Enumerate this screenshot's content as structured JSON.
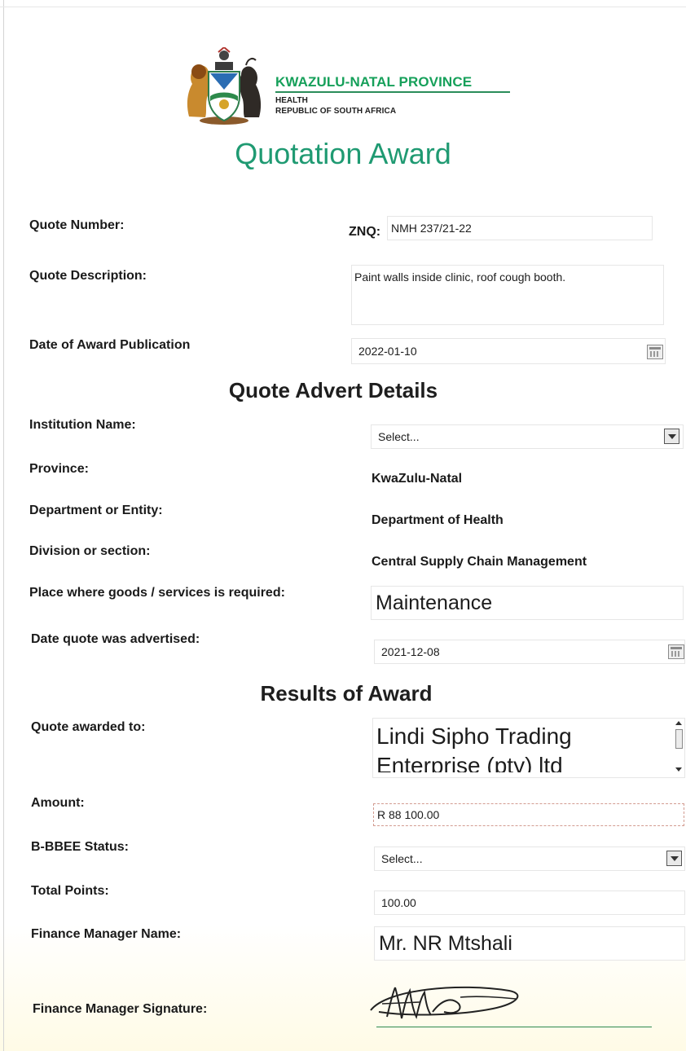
{
  "header": {
    "province": "KWAZULU-NATAL PROVINCE",
    "department": "HEALTH",
    "country": "REPUBLIC OF SOUTH AFRICA",
    "logo": "coat-of-arms-icon"
  },
  "title": "Quotation Award",
  "quote": {
    "number_label": "Quote Number:",
    "number_prefix": "ZNQ:",
    "number_value": "NMH 237/21-22",
    "description_label": "Quote Description:",
    "description_value": "Paint walls inside clinic, roof cough booth.",
    "award_date_label": "Date of Award Publication",
    "award_date_value": "2022-01-10"
  },
  "advert": {
    "heading": "Quote Advert Details",
    "institution_label": "Institution Name:",
    "institution_value": "Select...",
    "province_label": "Province:",
    "province_value": "KwaZulu-Natal",
    "department_label": "Department or Entity:",
    "department_value": "Department of Health",
    "division_label": "Division or section:",
    "division_value": "Central Supply Chain Management",
    "place_label": "Place where goods /  services is required:",
    "place_value": "Maintenance",
    "advertised_label": "Date quote was advertised:",
    "advertised_value": "2021-12-08"
  },
  "results": {
    "heading": "Results of Award",
    "awarded_label": "Quote awarded to:",
    "awarded_line1": "Lindi Sipho Trading",
    "awarded_line2": "Enterprise (pty) ltd",
    "amount_label": "Amount:",
    "amount_value": "R 88 100.00",
    "bbbee_label": "B-BBEE Status:",
    "bbbee_value": "Select...",
    "points_label": "Total Points:",
    "points_value": "100.00",
    "manager_label": "Finance Manager Name:",
    "manager_value": "Mr. NR Mtshali",
    "signature_label": "Finance Manager Signature:"
  },
  "colors": {
    "brand_green": "#16a05a",
    "title_teal": "#1f9a72"
  }
}
